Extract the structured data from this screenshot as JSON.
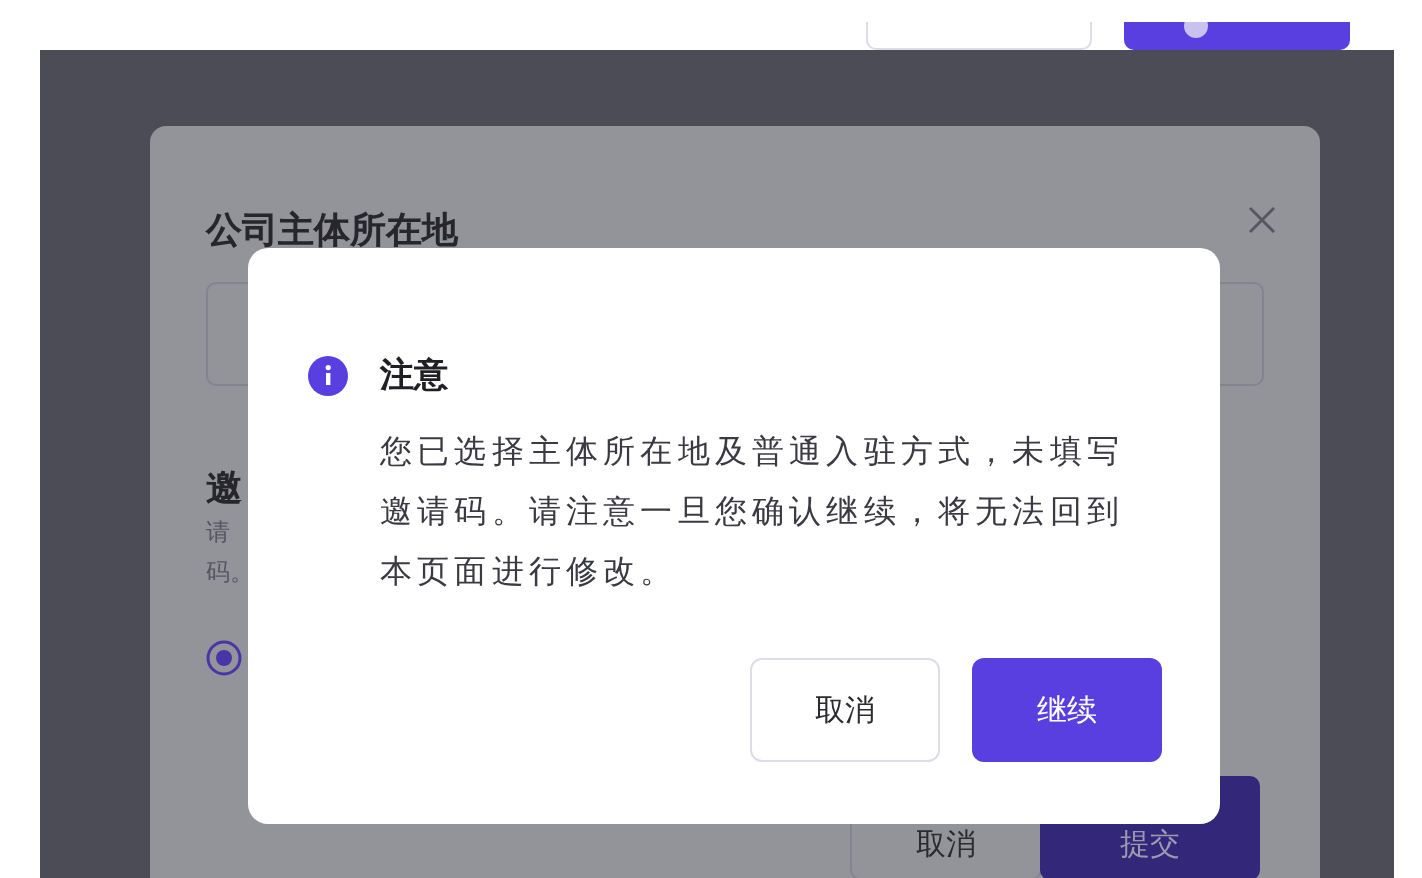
{
  "header": {
    "buttons": [
      {
        "kind": "outline"
      },
      {
        "kind": "primary"
      }
    ]
  },
  "background_modal": {
    "title": "公司主体所在地",
    "section_heading": "邀",
    "hint_lines": [
      "请",
      "码。"
    ],
    "radio": {
      "selected": true
    },
    "buttons": [
      {
        "label": "取消",
        "kind": "secondary"
      },
      {
        "label": "提交",
        "kind": "primary"
      }
    ]
  },
  "dialog": {
    "title": "注意",
    "message_lines": [
      "您已选择主体所在地及普通入驻方式，未填写",
      "邀请码。请注意一旦您确认继续，将无法回到",
      "本页面进行修改。"
    ],
    "buttons": [
      {
        "label": "取消",
        "kind": "secondary"
      },
      {
        "label": "继续",
        "kind": "primary"
      }
    ]
  }
}
